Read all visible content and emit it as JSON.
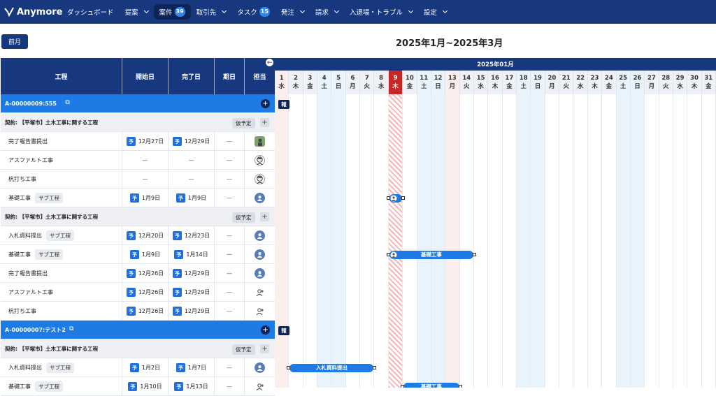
{
  "app": {
    "name": "Anymore"
  },
  "nav": [
    {
      "label": "ダッシュボード",
      "badge": null,
      "dropdown": false,
      "active": false
    },
    {
      "label": "提案",
      "badge": null,
      "dropdown": true,
      "active": false
    },
    {
      "label": "案件",
      "badge": "39",
      "dropdown": false,
      "active": true
    },
    {
      "label": "取引先",
      "badge": null,
      "dropdown": true,
      "active": false
    },
    {
      "label": "タスク",
      "badge": "15",
      "dropdown": false,
      "active": false
    },
    {
      "label": "発注",
      "badge": null,
      "dropdown": true,
      "active": false
    },
    {
      "label": "請求",
      "badge": null,
      "dropdown": true,
      "active": false
    },
    {
      "label": "入退場・トラブル",
      "badge": null,
      "dropdown": true,
      "active": false
    },
    {
      "label": "設定",
      "badge": null,
      "dropdown": true,
      "active": false
    }
  ],
  "toolbar": {
    "prev_label": "前月",
    "period": "2025年1月~2025年3月"
  },
  "columns": {
    "process": "工程",
    "start": "開始日",
    "end": "完了日",
    "duration": "期日",
    "assignee": "担当"
  },
  "calendar": {
    "month": "2025年01月",
    "today": 9,
    "days": [
      {
        "d": "1",
        "w": "水"
      },
      {
        "d": "2",
        "w": "木"
      },
      {
        "d": "3",
        "w": "金"
      },
      {
        "d": "4",
        "w": "土"
      },
      {
        "d": "5",
        "w": "日"
      },
      {
        "d": "6",
        "w": "月"
      },
      {
        "d": "7",
        "w": "火"
      },
      {
        "d": "8",
        "w": "水"
      },
      {
        "d": "9",
        "w": "木"
      },
      {
        "d": "10",
        "w": "金"
      },
      {
        "d": "11",
        "w": "土"
      },
      {
        "d": "12",
        "w": "日"
      },
      {
        "d": "13",
        "w": "月"
      },
      {
        "d": "14",
        "w": "火"
      },
      {
        "d": "15",
        "w": "水"
      },
      {
        "d": "16",
        "w": "木"
      },
      {
        "d": "17",
        "w": "金"
      },
      {
        "d": "18",
        "w": "土"
      },
      {
        "d": "19",
        "w": "日"
      },
      {
        "d": "20",
        "w": "月"
      },
      {
        "d": "21",
        "w": "火"
      },
      {
        "d": "22",
        "w": "水"
      },
      {
        "d": "23",
        "w": "木"
      },
      {
        "d": "24",
        "w": "金"
      },
      {
        "d": "25",
        "w": "土"
      },
      {
        "d": "26",
        "w": "日"
      },
      {
        "d": "27",
        "w": "月"
      },
      {
        "d": "28",
        "w": "火"
      },
      {
        "d": "29",
        "w": "水"
      },
      {
        "d": "30",
        "w": "木"
      },
      {
        "d": "31",
        "w": "金"
      }
    ]
  },
  "labels": {
    "sub_process": "サブ工程",
    "tentative": "仮予定",
    "plan_tag": "予",
    "report_tag": "報",
    "dash": "—"
  },
  "rows": [
    {
      "type": "project",
      "title": "A-00000009:555"
    },
    {
      "type": "contract",
      "title": "契約: 【平塚市】土木工事に関する工程"
    },
    {
      "type": "task",
      "name": "完了報告書提出",
      "sub": false,
      "start": "12月27日",
      "end": "12月29日",
      "avatar": "photo"
    },
    {
      "type": "task",
      "name": "アスファルト工事",
      "sub": false,
      "start": "",
      "end": "",
      "avatar": "face"
    },
    {
      "type": "task",
      "name": "杭打ち工事",
      "sub": false,
      "start": "",
      "end": "",
      "avatar": "face"
    },
    {
      "type": "task",
      "name": "基礎工事",
      "sub": true,
      "start": "1月9日",
      "end": "1月9日",
      "avatar": "blue"
    },
    {
      "type": "contract",
      "title": "契約: 【平塚市】土木工事に関する工程"
    },
    {
      "type": "task",
      "name": "入札資料提出",
      "sub": true,
      "start": "12月20日",
      "end": "12月23日",
      "avatar": "blue"
    },
    {
      "type": "task",
      "name": "基礎工事",
      "sub": true,
      "start": "1月9日",
      "end": "1月14日",
      "avatar": "blue"
    },
    {
      "type": "task",
      "name": "完了報告書提出",
      "sub": false,
      "start": "12月26日",
      "end": "12月29日",
      "avatar": "blue"
    },
    {
      "type": "task",
      "name": "アスファルト工事",
      "sub": false,
      "start": "12月26日",
      "end": "12月29日",
      "avatar": "add"
    },
    {
      "type": "task",
      "name": "杭打ち工事",
      "sub": false,
      "start": "12月26日",
      "end": "12月29日",
      "avatar": "add"
    },
    {
      "type": "project",
      "title": "A-00000007:テスト2"
    },
    {
      "type": "contract",
      "title": "契約: 【平塚市】土木工事に関する工程"
    },
    {
      "type": "task",
      "name": "入札資料提出",
      "sub": true,
      "start": "1月2日",
      "end": "1月7日",
      "avatar": "blue"
    },
    {
      "type": "task",
      "name": "基礎工事",
      "sub": true,
      "start": "1月10日",
      "end": "1月13日",
      "avatar": "add"
    }
  ],
  "bars": [
    {
      "row": 5,
      "start": 9,
      "end": 9,
      "label": "",
      "icon": true
    },
    {
      "row": 8,
      "start": 9,
      "end": 14,
      "label": "基礎工事",
      "icon": true
    },
    {
      "row": 14,
      "start": 2,
      "end": 7,
      "label": "入札資料提出",
      "icon": false
    },
    {
      "row": 15,
      "start": 10,
      "end": 13,
      "label": "基礎工事",
      "icon": false
    }
  ],
  "colors": {
    "navy": "#17387e",
    "accent": "#1e7be6",
    "today": "#c62828",
    "weekend": "#fdeeee",
    "holiday": "#e8f3fc"
  }
}
